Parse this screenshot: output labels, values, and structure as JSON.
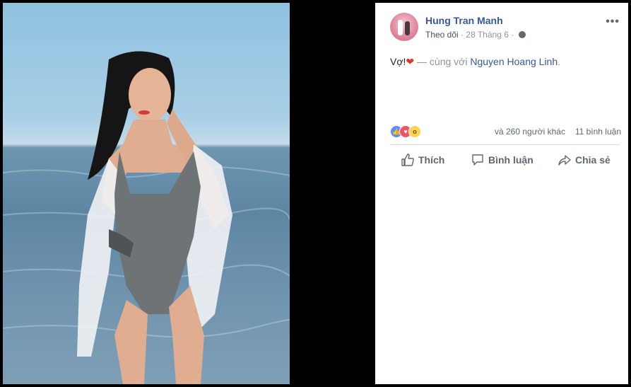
{
  "post": {
    "author": "Hung Tran Manh",
    "follow_label": "Theo dõi",
    "separator": "·",
    "date": "28 Tháng 6",
    "more_label": "•••",
    "text_prefix": "Vợ!",
    "heart": "❤",
    "with_text": "— cùng với",
    "tagged_person": "Nguyen Hoang Linh",
    "text_suffix": "."
  },
  "stats": {
    "others": "và 260 người khác",
    "comments": "11 bình luận"
  },
  "actions": {
    "like": "Thích",
    "comment": "Bình luận",
    "share": "Chia sẻ"
  },
  "icons": {
    "avatar": "profile-photo",
    "privacy": "globe-icon",
    "reactions": [
      "like-reaction-icon",
      "love-reaction-icon",
      "wow-reaction-icon"
    ]
  },
  "colors": {
    "link": "#365899",
    "meta": "#90949c",
    "action": "#606770"
  }
}
